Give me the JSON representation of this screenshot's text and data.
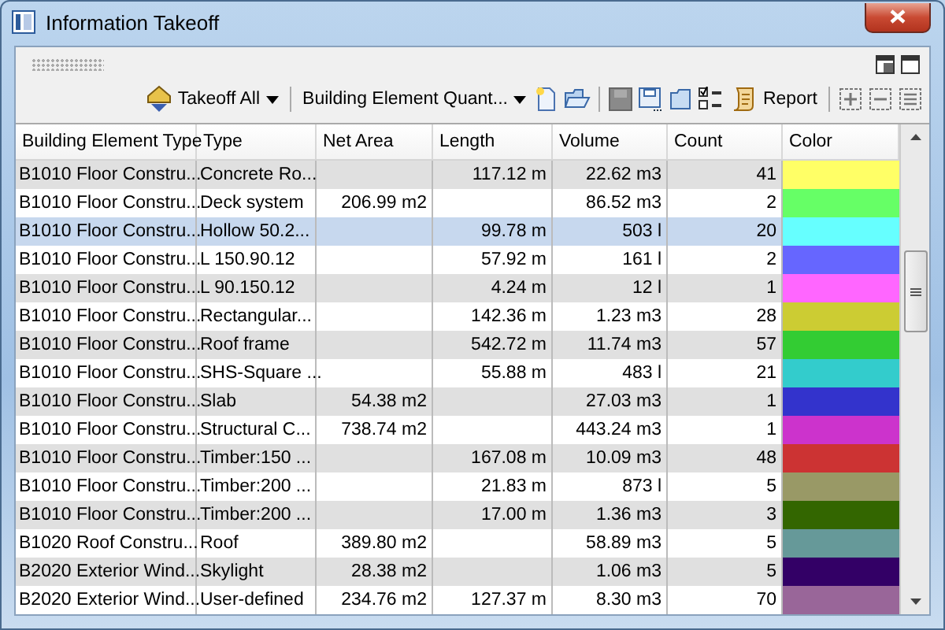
{
  "window": {
    "title": "Information Takeoff"
  },
  "toolbar": {
    "takeoff_dropdown": "Takeoff All",
    "template_dropdown": "Building Element Quant...",
    "report_button": "Report"
  },
  "table": {
    "columns": [
      "Building Element Type",
      "Type",
      "Net Area",
      "Length",
      "Volume",
      "Count",
      "Color"
    ],
    "rows": [
      {
        "element_type": "B1010 Floor Constru...",
        "type": "Concrete Ro...",
        "net_area": "",
        "length": "117.12 m",
        "volume": "22.62 m3",
        "count": "41",
        "color": "#ffff66",
        "selected": false
      },
      {
        "element_type": "B1010 Floor Constru...",
        "type": "Deck system",
        "net_area": "206.99 m2",
        "length": "",
        "volume": "86.52 m3",
        "count": "2",
        "color": "#66ff66",
        "selected": false
      },
      {
        "element_type": "B1010 Floor Constru...",
        "type": "Hollow 50.2...",
        "net_area": "",
        "length": "99.78 m",
        "volume": "503 l",
        "count": "20",
        "color": "#66ffff",
        "selected": true
      },
      {
        "element_type": "B1010 Floor Constru...",
        "type": "L 150.90.12",
        "net_area": "",
        "length": "57.92 m",
        "volume": "161 l",
        "count": "2",
        "color": "#6666ff",
        "selected": false
      },
      {
        "element_type": "B1010 Floor Constru...",
        "type": "L 90.150.12",
        "net_area": "",
        "length": "4.24 m",
        "volume": "12 l",
        "count": "1",
        "color": "#ff66ff",
        "selected": false
      },
      {
        "element_type": "B1010 Floor Constru...",
        "type": "Rectangular...",
        "net_area": "",
        "length": "142.36 m",
        "volume": "1.23 m3",
        "count": "28",
        "color": "#cccc33",
        "selected": false
      },
      {
        "element_type": "B1010 Floor Constru...",
        "type": "Roof frame",
        "net_area": "",
        "length": "542.72 m",
        "volume": "11.74 m3",
        "count": "57",
        "color": "#33cc33",
        "selected": false
      },
      {
        "element_type": "B1010 Floor Constru...",
        "type": "SHS-Square ...",
        "net_area": "",
        "length": "55.88 m",
        "volume": "483 l",
        "count": "21",
        "color": "#33cccc",
        "selected": false
      },
      {
        "element_type": "B1010 Floor Constru...",
        "type": "Slab",
        "net_area": "54.38 m2",
        "length": "",
        "volume": "27.03 m3",
        "count": "1",
        "color": "#3333cc",
        "selected": false
      },
      {
        "element_type": "B1010 Floor Constru...",
        "type": "Structural C...",
        "net_area": "738.74 m2",
        "length": "",
        "volume": "443.24 m3",
        "count": "1",
        "color": "#cc33cc",
        "selected": false
      },
      {
        "element_type": "B1010 Floor Constru...",
        "type": "Timber:150 ...",
        "net_area": "",
        "length": "167.08 m",
        "volume": "10.09 m3",
        "count": "48",
        "color": "#cc3333",
        "selected": false
      },
      {
        "element_type": "B1010 Floor Constru...",
        "type": "Timber:200 ...",
        "net_area": "",
        "length": "21.83 m",
        "volume": "873 l",
        "count": "5",
        "color": "#999966",
        "selected": false
      },
      {
        "element_type": "B1010 Floor Constru...",
        "type": "Timber:200 ...",
        "net_area": "",
        "length": "17.00 m",
        "volume": "1.36 m3",
        "count": "3",
        "color": "#336600",
        "selected": false
      },
      {
        "element_type": "B1020 Roof Constru...",
        "type": "Roof",
        "net_area": "389.80 m2",
        "length": "",
        "volume": "58.89 m3",
        "count": "5",
        "color": "#669999",
        "selected": false
      },
      {
        "element_type": "B2020 Exterior Wind...",
        "type": "Skylight",
        "net_area": "28.38 m2",
        "length": "",
        "volume": "1.06 m3",
        "count": "5",
        "color": "#330066",
        "selected": false
      },
      {
        "element_type": "B2020 Exterior Wind...",
        "type": "User-defined",
        "net_area": "234.76 m2",
        "length": "127.37 m",
        "volume": "8.30 m3",
        "count": "70",
        "color": "#996699",
        "selected": false
      }
    ]
  }
}
